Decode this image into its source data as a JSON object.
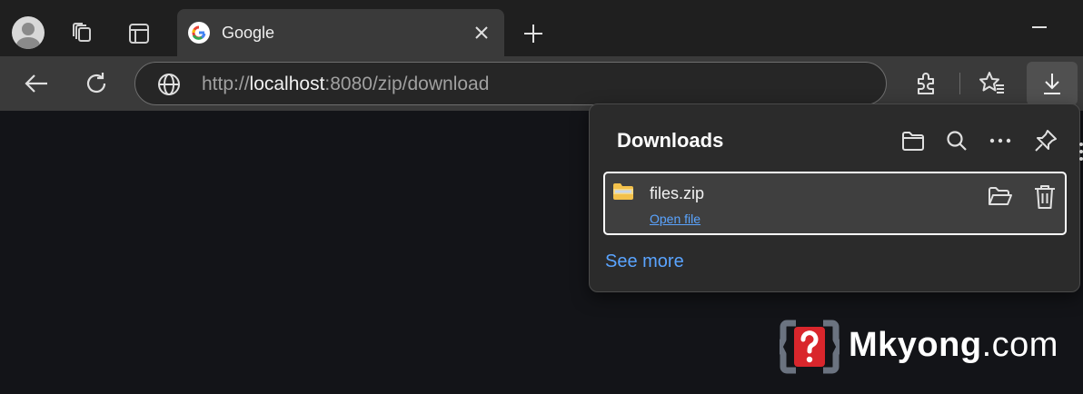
{
  "tabs": [
    {
      "title": "Google",
      "favicon": "google-g-icon"
    }
  ],
  "address_bar": {
    "scheme": "http://",
    "host": "localhost",
    "rest": ":8080/zip/download"
  },
  "downloads": {
    "title": "Downloads",
    "items": [
      {
        "filename": "files.zip",
        "action_label": "Open file"
      }
    ],
    "see_more_label": "See more"
  },
  "watermark": {
    "brand": "Mkyong",
    "suffix": ".com"
  },
  "colors": {
    "accent_link": "#5aa4ff",
    "panel_bg": "#2b2b2b",
    "toolbar_bg": "#3a3a3a"
  },
  "icons": [
    "profile-avatar",
    "workspaces-icon",
    "vertical-tabs-icon",
    "close-icon",
    "plus-icon",
    "minimize-icon",
    "back-arrow-icon",
    "refresh-icon",
    "globe-icon",
    "extensions-icon",
    "favorites-icon",
    "download-icon",
    "folder-icon",
    "search-icon",
    "more-icon",
    "pin-icon",
    "zip-folder-icon",
    "trash-icon"
  ]
}
